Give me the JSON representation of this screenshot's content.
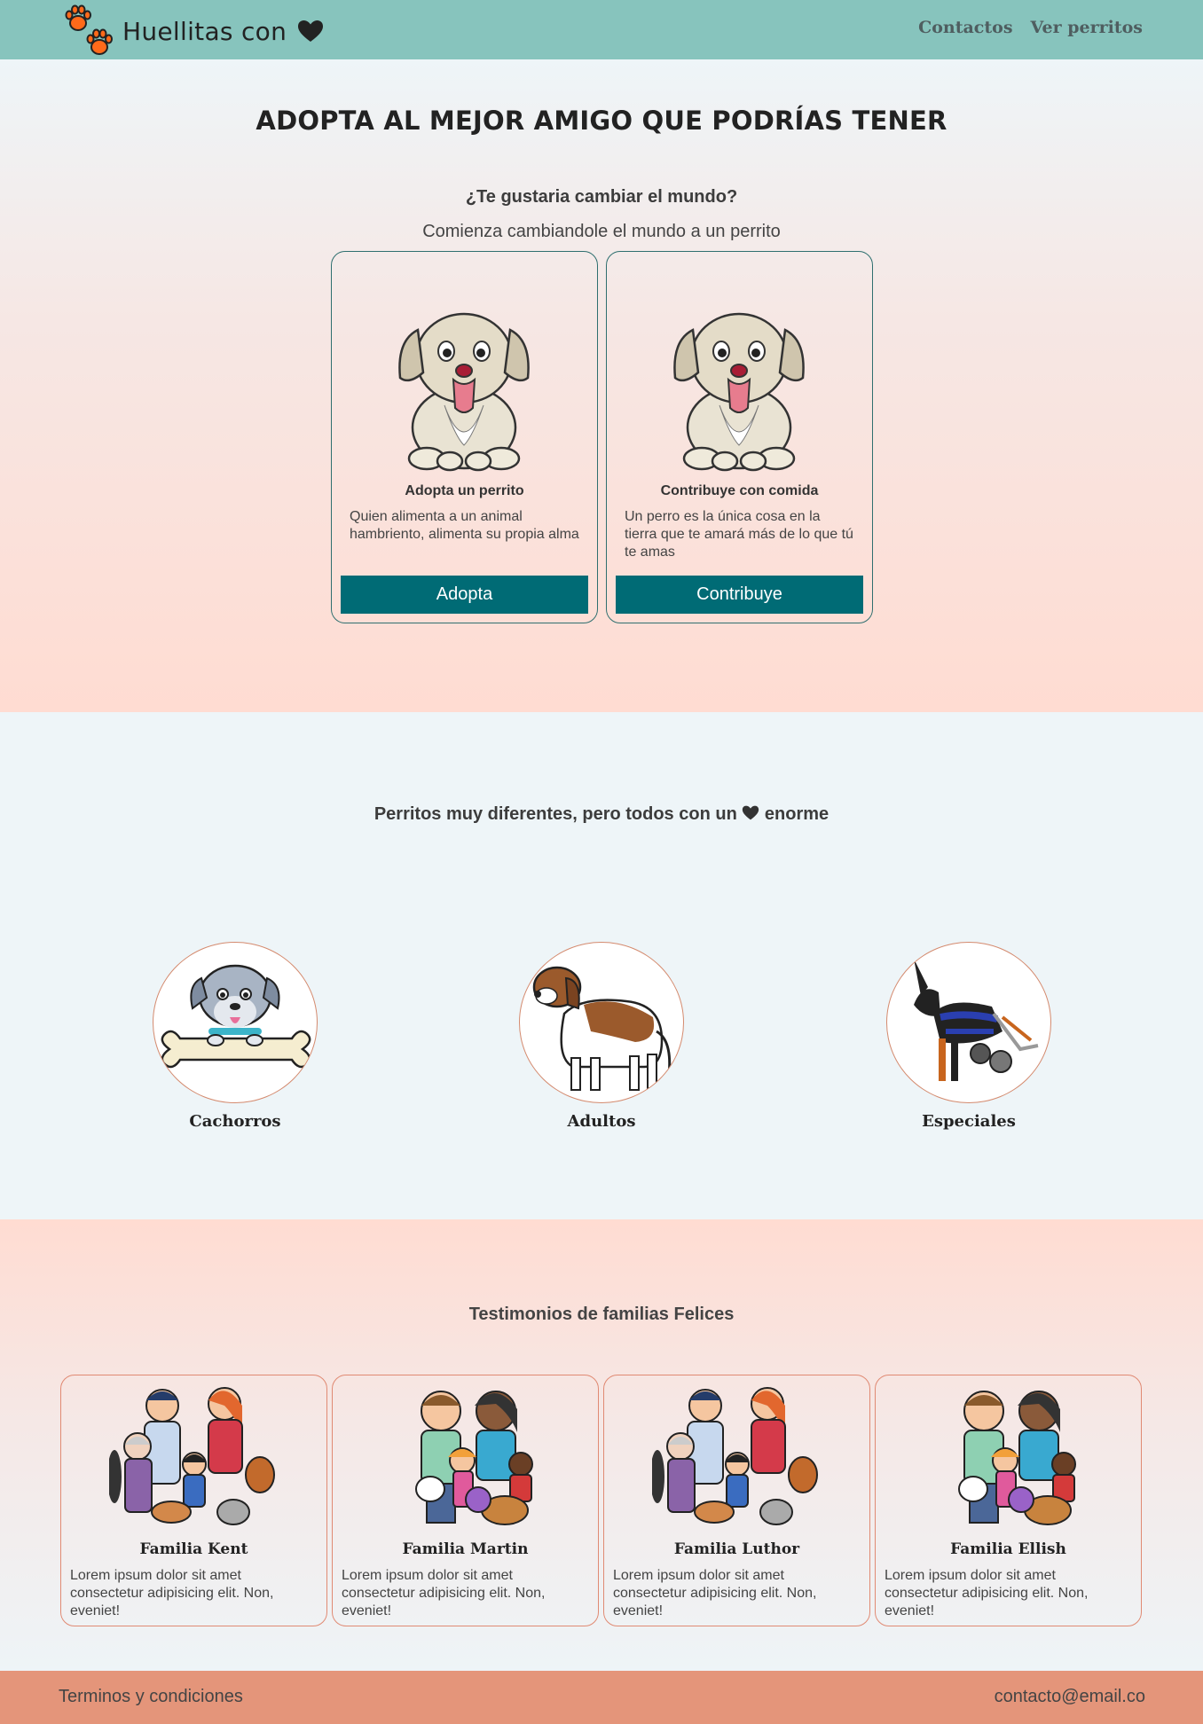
{
  "nav": {
    "brand": "Huellitas con",
    "links": [
      "Contactos",
      "Ver perritos"
    ]
  },
  "hero": {
    "title": "ADOPTA AL MEJOR AMIGO QUE PODRÍAS TENER",
    "question": "¿Te gustaria cambiar el mundo?",
    "subtitle": "Comienza cambiandole el mundo a un perrito",
    "cards": [
      {
        "title": "Adopta un perrito",
        "text": "Quien alimenta a un animal hambriento, alimenta su propia alma",
        "button": "Adopta"
      },
      {
        "title": "Contribuye con comida",
        "text": "Un perro es la única cosa en la tierra que te amará más de lo que tú te amas",
        "button": "Contribuye"
      }
    ]
  },
  "dogs": {
    "title_before": "Perritos muy diferentes, pero todos con un",
    "title_after": "enorme",
    "categories": [
      "Cachorros",
      "Adultos",
      "Especiales"
    ]
  },
  "testimonials": {
    "title": "Testimonios de familias Felices",
    "items": [
      {
        "name": "Familia Kent",
        "text": "Lorem ipsum dolor sit amet consectetur adipisicing elit. Non, eveniet!"
      },
      {
        "name": "Familia Martin",
        "text": "Lorem ipsum dolor sit amet consectetur adipisicing elit. Non, eveniet!"
      },
      {
        "name": "Familia Luthor",
        "text": "Lorem ipsum dolor sit amet consectetur adipisicing elit. Non, eveniet!"
      },
      {
        "name": "Familia Ellish",
        "text": "Lorem ipsum dolor sit amet consectetur adipisicing elit. Non, eveniet!"
      }
    ]
  },
  "footer": {
    "left": "Terminos y condiciones",
    "right": "contacto@email.co"
  },
  "icons": {
    "logo": "paw-prints-icon",
    "heart": "heart-icon"
  },
  "colors": {
    "nav": "#87c4bd",
    "button": "#006b75",
    "footer": "#e4957a",
    "accent_border": "#e08a73"
  }
}
